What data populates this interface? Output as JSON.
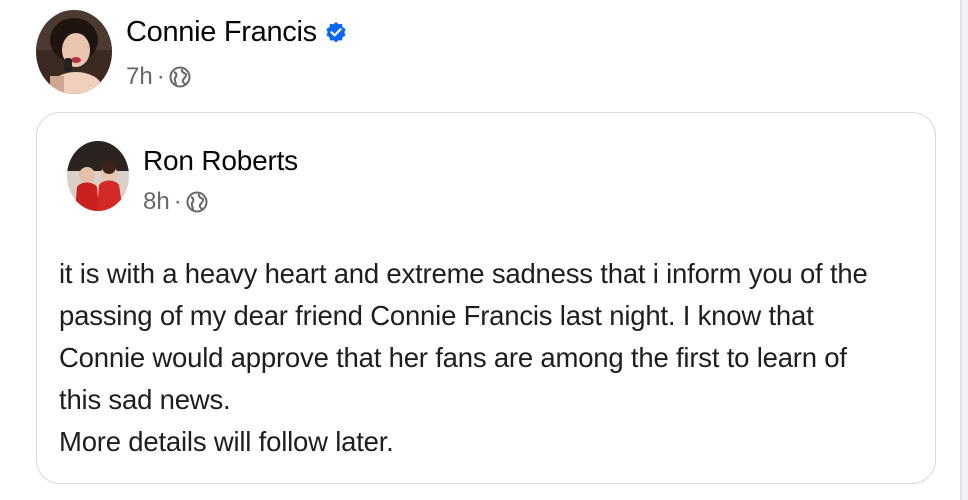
{
  "post": {
    "author": {
      "name": "Connie Francis",
      "verified": true,
      "verified_icon": "verified-badge-icon",
      "time": "7h",
      "separator": "·",
      "audience_icon": "globe-icon"
    },
    "shared_post": {
      "author": {
        "name": "Ron Roberts",
        "time": "8h",
        "separator": "·",
        "audience_icon": "globe-icon"
      },
      "text_lines": {
        "l1": "it is with a heavy heart and extreme sadness that i inform you of the",
        "l2": "passing of my dear friend Connie Francis last night. I know that",
        "l3": "Connie would approve that her fans are among the first to learn of",
        "l4": "this sad news.",
        "l5": "More details will follow later."
      }
    }
  },
  "colors": {
    "verified_blue": "#0866ff",
    "meta_gray": "#65676b",
    "card_border": "#d6d8dc"
  }
}
